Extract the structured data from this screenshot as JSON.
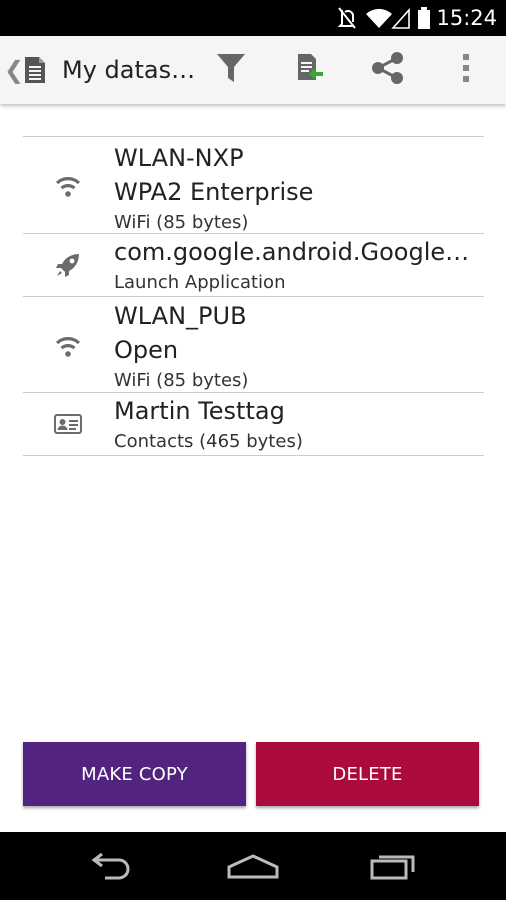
{
  "status_bar": {
    "time": "15:24",
    "icons": [
      "mute-icon",
      "wifi-icon",
      "signal-icon",
      "battery-icon"
    ]
  },
  "action_bar": {
    "title": "My datas…",
    "back_glyph": "❮",
    "actions": [
      "filter-icon",
      "import-icon",
      "share-icon",
      "overflow-menu-icon"
    ]
  },
  "records": [
    {
      "icon": "wifi-icon",
      "lines": [
        "WLAN-NXP",
        "WPA2 Enterprise"
      ],
      "subtitle": "WiFi (85 bytes)"
    },
    {
      "icon": "rocket-icon",
      "lines": [
        "com.google.android.GoogleCa…"
      ],
      "subtitle": "Launch Application"
    },
    {
      "icon": "wifi-icon",
      "lines": [
        "WLAN_PUB",
        "Open"
      ],
      "subtitle": "WiFi (85 bytes)"
    },
    {
      "icon": "contact-card-icon",
      "lines": [
        "Martin Testtag"
      ],
      "subtitle": "Contacts (465 bytes)"
    }
  ],
  "buttons": {
    "make_copy": "MAKE COPY",
    "delete": "DELETE"
  },
  "colors": {
    "make_copy": "#52247f",
    "delete": "#aa0a3c",
    "icon_gray": "#6b6b6b",
    "divider": "#cccccc"
  },
  "nav_bar": [
    "back-icon",
    "home-icon",
    "recents-icon"
  ]
}
